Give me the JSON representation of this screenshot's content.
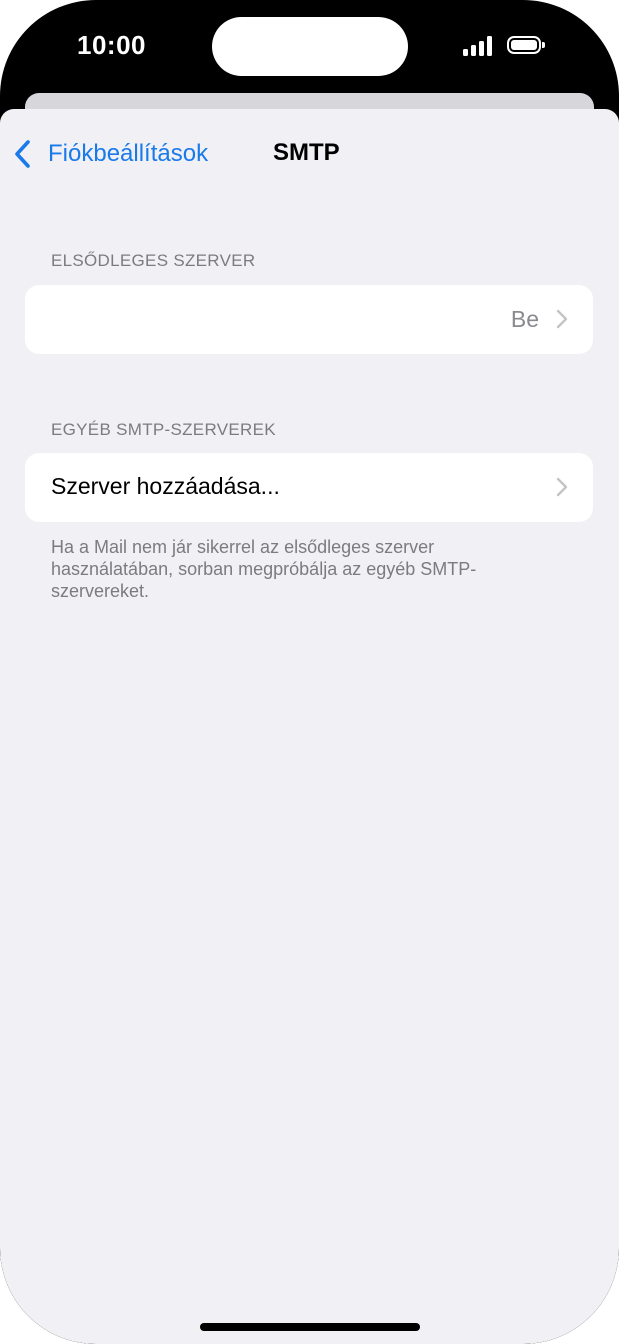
{
  "status_bar": {
    "time": "10:00",
    "icons": [
      "signal-bars-icon",
      "battery-icon"
    ]
  },
  "nav": {
    "back_label": "Fiókbeállítások",
    "back_icon": "chevron-left-icon",
    "title": "SMTP"
  },
  "sections": {
    "primary": {
      "header": "ELSŐDLEGES SZERVER",
      "row_value": "Be"
    },
    "other": {
      "header": "EGYÉB SMTP-SZERVEREK",
      "add_label": "Szerver hozzáadása...",
      "footer": "Ha a Mail nem jár sikerrel az elsődleges szerver használatában, sorban megpróbálja az egyéb SMTP-szervereket."
    }
  },
  "colors": {
    "accent": "#1a7aea",
    "background": "#f0f0f5",
    "secondary_text": "#7b7b80"
  }
}
